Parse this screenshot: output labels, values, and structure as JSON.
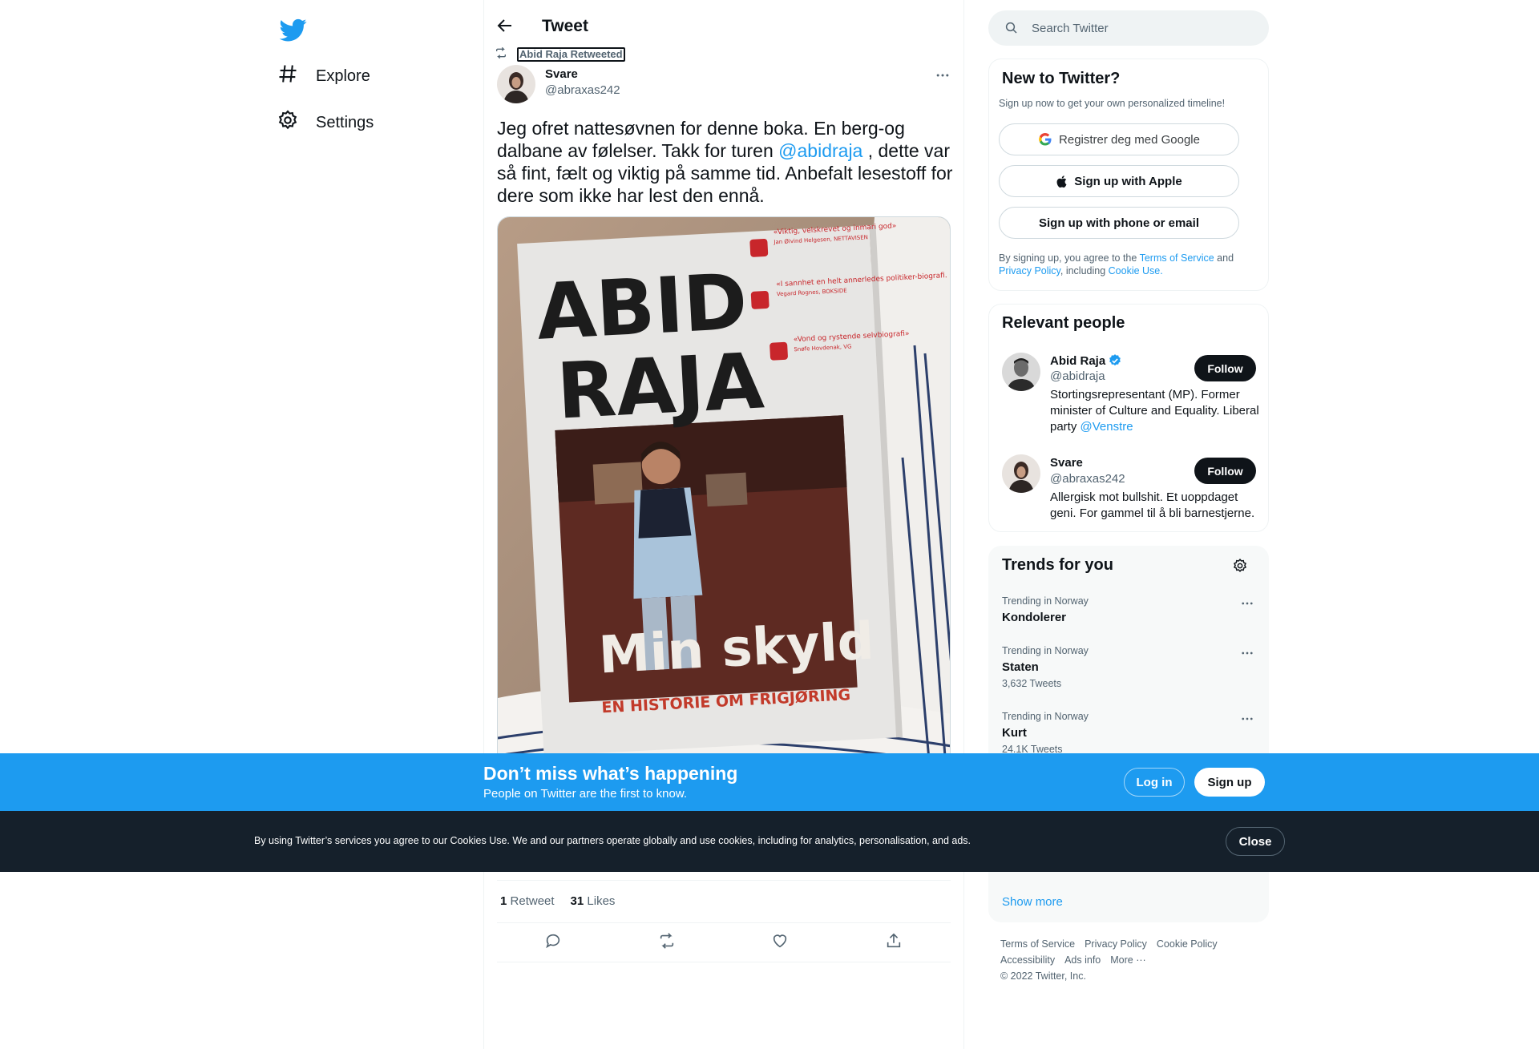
{
  "nav": {
    "items": [
      {
        "label": "Explore",
        "icon": "hashtag-icon"
      },
      {
        "label": "Settings",
        "icon": "gear-icon"
      }
    ]
  },
  "header": {
    "title": "Tweet"
  },
  "tweet": {
    "retweeted_by": "Abid Raja Retweeted",
    "author_name": "Svare",
    "author_handle": "@abraxas242",
    "text_part1": "Jeg ofret nattesøvnen for denne boka. En berg-og dalbane av følelser. Takk for turen ",
    "mention": "@abidraja",
    "text_part2": " , dette var så fint, fælt og viktig på samme tid. Anbefalt lesestoff for dere som ikke har lest den ennå.",
    "media": {
      "book_title_line1": "ABID",
      "book_title_line2": "RAJA",
      "book_subtitle": "Min skyld",
      "book_tagline": "EN HISTORIE OM FRIGJØRING",
      "quotes": [
        {
          "text": "«Viktig, velskrevet og inmari god»",
          "source": "Jan Øivind Helgesen, NETTAVISEN"
        },
        {
          "text": "«I sannhet en helt annerledes politiker-biografi. Og takk for det.»",
          "source": "Vegard Rognes, BOKSIDE"
        },
        {
          "text": "«Vond og rystende selvbiografi»",
          "source": "Snøfe Hovdenak, VG"
        }
      ]
    },
    "stats": {
      "retweets_count": "1",
      "retweets_label": "Retweet",
      "likes_count": "31",
      "likes_label": "Likes"
    }
  },
  "search": {
    "placeholder": "Search Twitter"
  },
  "new_to_twitter": {
    "title": "New to Twitter?",
    "subtitle": "Sign up now to get your own personalized timeline!",
    "google_btn": "Registrer deg med Google",
    "apple_btn": "Sign up with Apple",
    "phone_btn": "Sign up with phone or email",
    "terms_prefix": "By signing up, you agree to the ",
    "terms_link": "Terms of Service",
    "terms_and": " and",
    "privacy_link": "Privacy Policy",
    "including": ", including ",
    "cookie_link": "Cookie Use."
  },
  "relevant_people": {
    "title": "Relevant people",
    "people": [
      {
        "name": "Abid Raja",
        "handle": "@abidraja",
        "bio": "Stortingsrepresentant (MP). Former minister of Culture and Equality. Liberal party ",
        "bio_mention": "@Venstre",
        "follow": "Follow"
      },
      {
        "name": "Svare",
        "handle": "@abraxas242",
        "bio": "Allergisk mot bullshit. Et uoppdaget geni. For gammel til å bli barnestjerne.",
        "follow": "Follow"
      }
    ]
  },
  "trends": {
    "title": "Trends for you",
    "items": [
      {
        "context": "Trending in Norway",
        "name": "Kondolerer",
        "count": ""
      },
      {
        "context": "Trending in Norway",
        "name": "Staten",
        "count": "3,632 Tweets"
      },
      {
        "context": "Trending in Norway",
        "name": "Kurt",
        "count": "24.1K Tweets"
      }
    ],
    "show_more": "Show more"
  },
  "footer": {
    "links": [
      "Terms of Service",
      "Privacy Policy",
      "Cookie Policy",
      "Accessibility",
      "Ads info",
      "More ···"
    ],
    "copyright": "© 2022 Twitter, Inc."
  },
  "banner": {
    "title": "Don’t miss what’s happening",
    "subtitle": "People on Twitter are the first to know.",
    "login": "Log in",
    "signup": "Sign up"
  },
  "cookie": {
    "text": "By using Twitter’s services you agree to our Cookies Use. We and our partners operate globally and use cookies, including for analytics, personalisation, and ads.",
    "close": "Close"
  },
  "colors": {
    "brand": "#1d9bf0",
    "text": "#0f1419",
    "secondary": "#536471",
    "dark_banner": "#15202b"
  }
}
